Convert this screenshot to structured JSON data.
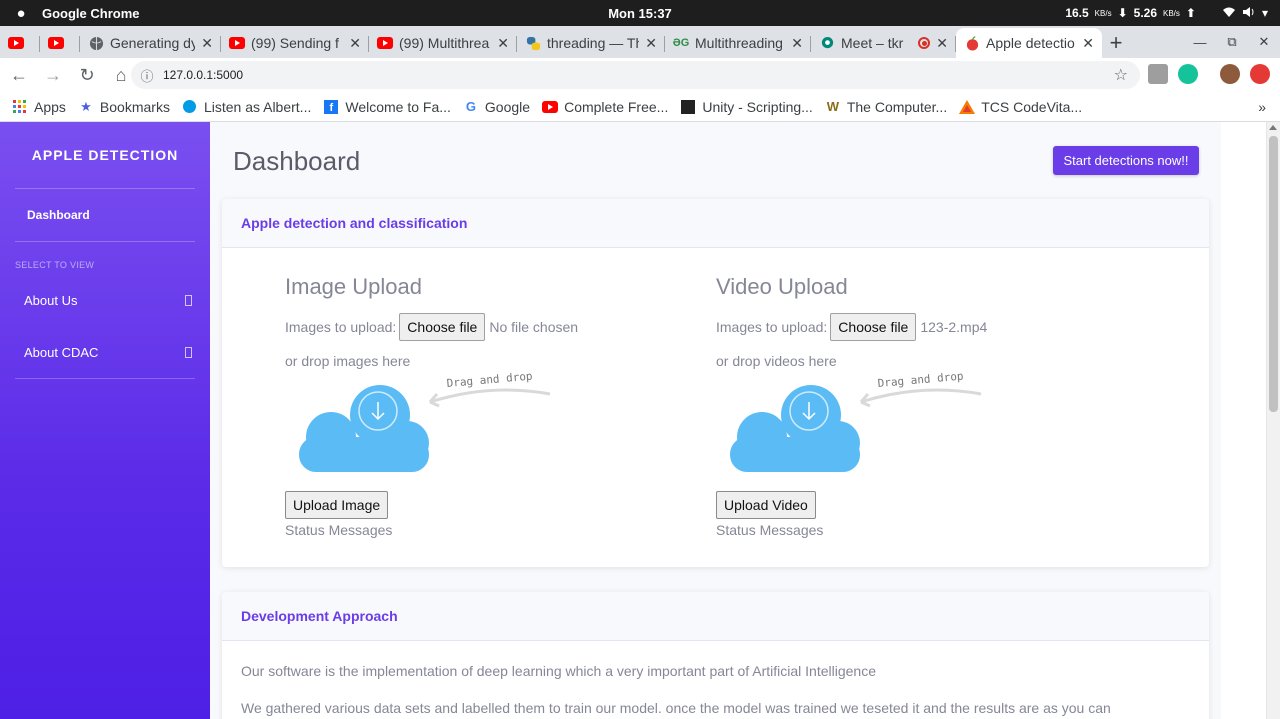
{
  "os": {
    "app_name": "Google Chrome",
    "clock": "Mon 15:37",
    "net_down": "16.5",
    "net_down_unit": "KB/s",
    "net_up": "5.26",
    "net_up_unit": "KB/s"
  },
  "tabs": [
    {
      "label": "",
      "icon": "youtube-icon"
    },
    {
      "label": "",
      "icon": "youtube-icon"
    },
    {
      "label": "Generating dy",
      "icon": "globe-icon"
    },
    {
      "label": "(99) Sending f",
      "icon": "youtube-icon"
    },
    {
      "label": "(99) Multithrea",
      "icon": "youtube-icon"
    },
    {
      "label": "threading — Th",
      "icon": "python-icon"
    },
    {
      "label": "Multithreading",
      "icon": "geeksforgeeks-icon"
    },
    {
      "label": "Meet – tkr",
      "icon": "meet-icon"
    },
    {
      "label": "Apple detectio",
      "icon": "apple-fruit-icon"
    }
  ],
  "address": {
    "url": "127.0.0.1:5000"
  },
  "bookmarks": [
    {
      "label": "Apps",
      "icon": "apps-grid-icon"
    },
    {
      "label": "Bookmarks",
      "icon": "star-icon"
    },
    {
      "label": "Listen as Albert...",
      "icon": "listen-icon"
    },
    {
      "label": "Welcome to Fa...",
      "icon": "facebook-icon"
    },
    {
      "label": "Google",
      "icon": "google-icon"
    },
    {
      "label": "Complete Free...",
      "icon": "youtube-icon"
    },
    {
      "label": "Unity - Scripting...",
      "icon": "unity-icon"
    },
    {
      "label": "The Computer...",
      "icon": "computer-icon"
    },
    {
      "label": "TCS CodeVita...",
      "icon": "tcs-icon"
    }
  ],
  "bookmarks_more": "»",
  "sidebar": {
    "brand": "APPLE DETECTION",
    "active_item": "Dashboard",
    "section_heading": "SELECT TO VIEW",
    "items": [
      {
        "label": "About Us"
      },
      {
        "label": "About CDAC"
      }
    ]
  },
  "main": {
    "title": "Dashboard",
    "cta_label": "Start detections now!!",
    "card1": {
      "header": "Apple detection and classification",
      "image_upload": {
        "title": "Image Upload",
        "prompt": "Images to upload:",
        "file_button": "Choose file",
        "file_status": "No file chosen",
        "drop_text": "or drop images here",
        "illustration_text": "Drag and drop",
        "action_button": "Upload Image",
        "status": "Status Messages"
      },
      "video_upload": {
        "title": "Video Upload",
        "prompt": "Images to upload:",
        "file_button": "Choose file",
        "file_status": "123-2.mp4",
        "drop_text": "or drop videos here",
        "illustration_text": "Drag and drop",
        "action_button": "Upload Video",
        "status": "Status Messages"
      }
    },
    "card2": {
      "header": "Development Approach",
      "paragraph1": "Our software is the implementation of deep learning which a very important part of Artificial Intelligence",
      "paragraph2": "We gathered various data sets and labelled them to train our model. once the model was trained we teseted it and the results are as you can"
    }
  },
  "colors": {
    "accent": "#6a3de8",
    "sidebar_top": "#7a4ff0",
    "sidebar_bottom": "#4e1fe6",
    "cloud": "#5bbcf5"
  }
}
